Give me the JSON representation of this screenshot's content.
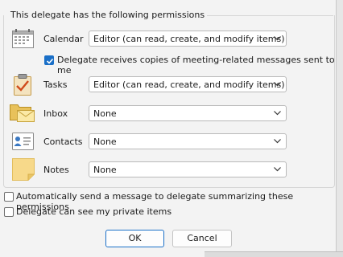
{
  "group_title": "This delegate has the following permissions",
  "rows": [
    {
      "label": "Calendar",
      "icon": "calendar-icon",
      "value": "Editor (can read, create, and modify items)"
    },
    {
      "label": "Tasks",
      "icon": "tasks-icon",
      "value": "Editor (can read, create, and modify items)"
    },
    {
      "label": "Inbox",
      "icon": "inbox-icon",
      "value": "None"
    },
    {
      "label": "Contacts",
      "icon": "contacts-icon",
      "value": "None"
    },
    {
      "label": "Notes",
      "icon": "notes-icon",
      "value": "None"
    }
  ],
  "meeting_copies": {
    "label": "Delegate receives copies of meeting-related messages sent to me",
    "checked": true
  },
  "auto_send": {
    "label": "Automatically send a message to delegate summarizing these permissions",
    "checked": false
  },
  "private_items": {
    "label": "Delegate can see my private items",
    "checked": false
  },
  "buttons": {
    "ok": "OK",
    "cancel": "Cancel"
  },
  "colors": {
    "accent": "#1a6fc7",
    "background": "#f3f3f3"
  }
}
